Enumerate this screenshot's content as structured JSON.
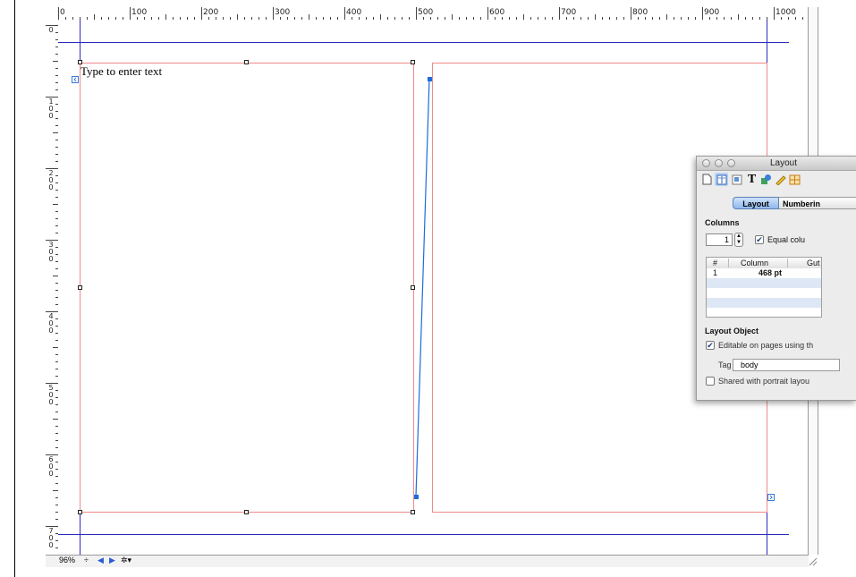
{
  "canvas": {
    "placeholder_text": "Type to enter text"
  },
  "ruler": {
    "top_labels": [
      "0",
      "100",
      "200",
      "300",
      "400",
      "500",
      "600",
      "700",
      "800",
      "900",
      "1000"
    ],
    "left_labels": [
      "0",
      "100",
      "200",
      "300",
      "400",
      "500",
      "600",
      "700"
    ]
  },
  "status_bar": {
    "zoom": "96%",
    "zoom_stepper": "÷",
    "prev_page": "◀",
    "next_page": "▶",
    "action_menu": "✲▾"
  },
  "inspector": {
    "title": "Layout",
    "toolbar_icons": [
      "document-icon",
      "layout-icon",
      "wrap-icon",
      "text-icon",
      "graphic-icon",
      "metrics-icon",
      "table-icon"
    ],
    "tabs": {
      "layout": "Layout",
      "numbering": "Numberin"
    },
    "columns_heading": "Columns",
    "columns_count": "1",
    "equal_columns_label": "Equal colu",
    "equal_columns_checked": true,
    "table": {
      "headers": [
        "#",
        "Column",
        "Gut"
      ],
      "rows": [
        {
          "number": "1",
          "column": "468 pt",
          "gutter": ""
        }
      ]
    },
    "layout_object_heading": "Layout Object",
    "editable_label": "Editable on pages using th",
    "editable_checked": true,
    "tag_label": "Tag",
    "tag_value": "body",
    "shared_label": "Shared with portrait layou",
    "shared_checked": false
  },
  "colors": {
    "margin_guide": "#2b2bbf",
    "text_frame": "#ef8a8a",
    "link_line": "#1f6bdb",
    "selected_tab": "#a8c8f0"
  }
}
